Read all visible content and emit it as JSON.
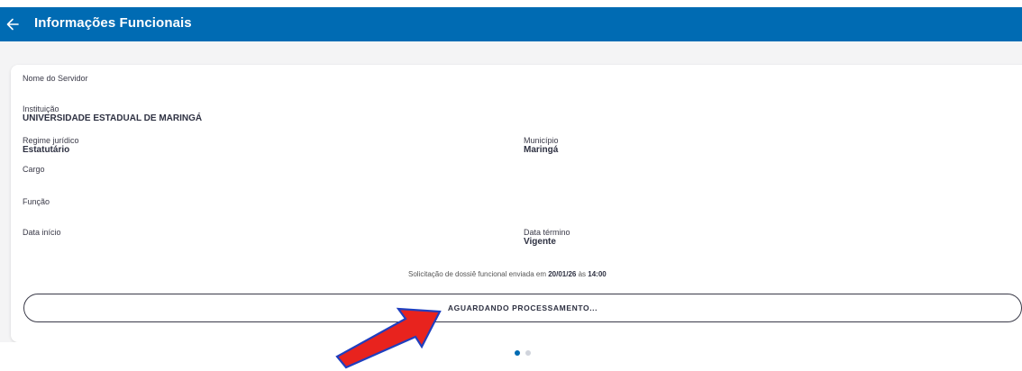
{
  "header": {
    "title": "Informações Funcionais",
    "back_icon": "arrow-left-icon",
    "background_color": "#006bb3"
  },
  "card": {
    "servidor": {
      "label": "Nome do Servidor"
    },
    "instituicao": {
      "label": "Instituição",
      "value": "UNIVERSIDADE ESTADUAL DE MARINGÁ"
    },
    "regime": {
      "label": "Regime jurídico",
      "value": "Estatutário"
    },
    "municipio": {
      "label": "Município",
      "value": "Maringá"
    },
    "cargo": {
      "label": "Cargo"
    },
    "funcao": {
      "label": "Função"
    },
    "data_inicio": {
      "label": "Data início"
    },
    "data_termino": {
      "label": "Data término",
      "value": "Vigente"
    },
    "solicitacao": {
      "prefix": "Solicitação de dossiê funcional enviada em",
      "date": "20/01/26",
      "connector": "às",
      "time": "14:00"
    },
    "status_button_label": "AGUARDANDO PROCESSAMENTO..."
  },
  "pagination": {
    "current": 1,
    "total": 2
  },
  "annotation": {
    "arrow_color": "#e8231e",
    "arrow_outline": "#1f3fbf"
  }
}
